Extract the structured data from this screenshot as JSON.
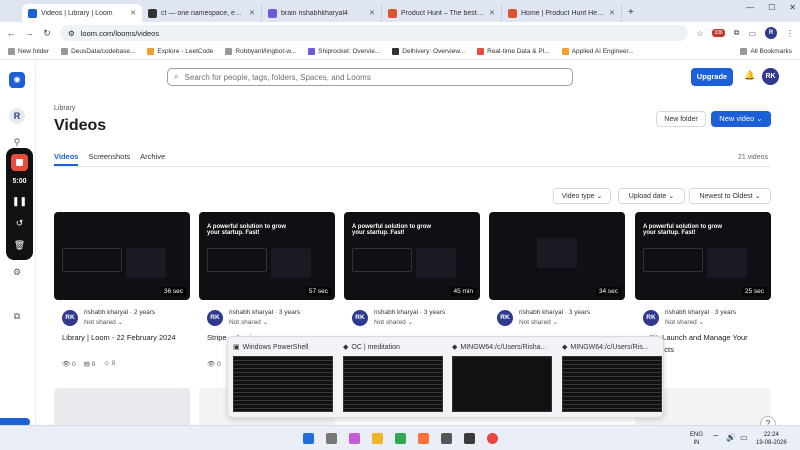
{
  "browser": {
    "tabs": [
      {
        "title": "Videos | Library | Loom",
        "active": true,
        "color": "#1c5fd6"
      },
      {
        "title": "ct — one namespace, every m",
        "color": "#333333"
      },
      {
        "title": "brain  rishabhkharyal4",
        "color": "#6b5bd6"
      },
      {
        "title": "Product Hunt – The best new p",
        "color": "#da552f"
      },
      {
        "title": "Home | Product Hunt Help Cent",
        "color": "#da552f"
      }
    ],
    "url": "loom.com/looms/videos",
    "badge": "336",
    "bookmarks": [
      "New folder",
      "DeusData/codebase...",
      "Explore - LeetCode",
      "Robbyant/lingbot-w...",
      "Shiprocket: Overvie...",
      "Delhivery: Overview...",
      "Real-time Data & Pl...",
      "Applied AI Engineer..."
    ],
    "all_bookmarks": "All Bookmarks"
  },
  "header": {
    "search_placeholder": "Search for people, tags, folders, Spaces, and Looms",
    "upgrade": "Upgrade",
    "avatar": "RK"
  },
  "sidebar": {
    "avatar": "R"
  },
  "recorder": {
    "time": "5:00"
  },
  "library": {
    "breadcrumb": "Library",
    "title": "Videos",
    "new_folder": "New folder",
    "new_video": "New video",
    "tabs": [
      "Videos",
      "Screenshots",
      "Archive"
    ],
    "count": "21 videos",
    "filters": [
      "Video type",
      "Upload date",
      "Newest to Oldest"
    ]
  },
  "videos": [
    {
      "duration": "36 sec",
      "owner": "rishabh kharyal",
      "age": "2 years",
      "shared": "Not shared",
      "title": "Library | Loom - 22 February 2024",
      "views": "0",
      "comments": "0",
      "reactions": "0",
      "thumb": ""
    },
    {
      "duration": "57 sec",
      "owner": "rishabh kharyal",
      "age": "3 years",
      "shared": "Not shared",
      "title": "Stripe ... Login",
      "views": "0",
      "comments": "0",
      "reactions": "0",
      "thumb": "A powerful solution to grow your startup. Fast!"
    },
    {
      "duration": "45 min",
      "owner": "rishabh kharyal",
      "age": "3 years",
      "shared": "Not shared",
      "title": "",
      "views": "",
      "comments": "",
      "reactions": "",
      "thumb": "A powerful solution to grow your startup. Fast!"
    },
    {
      "duration": "34 sec",
      "owner": "rishabh kharyal",
      "age": "3 years",
      "shared": "Not shared",
      "title": "",
      "views": "",
      "comments": "",
      "reactions": "",
      "thumb": ""
    },
    {
      "duration": "25 sec",
      "owner": "rishabh kharyal",
      "age": "3 years",
      "shared": "Not shared",
      "title": "...Kit: Launch and Manage Your ...roducts",
      "views": "",
      "comments": "",
      "reactions": "",
      "thumb": "A powerful solution to grow your startup. Fast!"
    }
  ],
  "taskbar_preview": [
    {
      "label": "Windows PowerShell"
    },
    {
      "label": "OC | meditation"
    },
    {
      "label": "MINGW64:/c/Users/Risha..."
    },
    {
      "label": "MINGW64:/c/Users/Ris..."
    }
  ],
  "tray": {
    "lang": "ENG",
    "region": "IN",
    "time": "22:24",
    "date": "19-08-2026"
  },
  "help": "?"
}
